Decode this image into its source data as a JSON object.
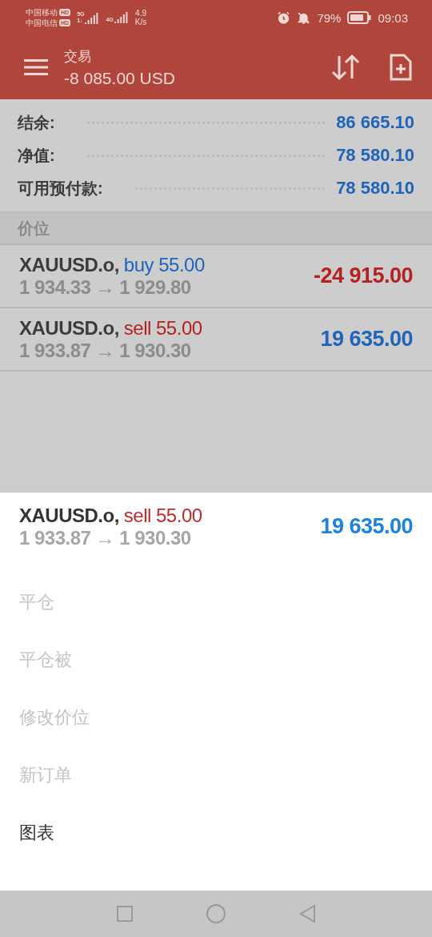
{
  "status_bar": {
    "carriers": [
      {
        "name": "中国移动",
        "badge": "HD"
      },
      {
        "name": "中国电信",
        "badge": "HD"
      }
    ],
    "networks": [
      {
        "label": "5G",
        "sub": "1↓"
      },
      {
        "label": "4G"
      }
    ],
    "speed": [
      "4.9",
      "K/s"
    ],
    "battery": "79%",
    "time": "09:03"
  },
  "header": {
    "title": "交易",
    "balance": "-8 085.00 USD"
  },
  "summary": [
    {
      "label": "结余:",
      "value": "86 665.10"
    },
    {
      "label": "净值:",
      "value": "78 580.10"
    },
    {
      "label": "可用预付款:",
      "value": "78 580.10"
    }
  ],
  "section": "价位",
  "positions": [
    {
      "symbol": "XAUUSD.o,",
      "volume": {
        "text": "buy 55.00",
        "color": "#1f64b8"
      },
      "prices": "1 934.33 → 1 929.80",
      "profit": {
        "text": "-24 915.00",
        "color": "#b32222"
      }
    },
    {
      "symbol": "XAUUSD.o,",
      "volume": {
        "text": "sell 55.00",
        "color": "#b32222"
      },
      "prices": "1 933.87 → 1 930.30",
      "profit": {
        "text": "19 635.00",
        "color": "#1f64b8"
      }
    }
  ],
  "sheet": {
    "position": {
      "symbol": "XAUUSD.o,",
      "volume": {
        "text": "sell 55.00",
        "color": "#c22a2a"
      },
      "prices": "1 933.87 → 1 930.30",
      "profit": {
        "text": "19 635.00",
        "color": "#1a82e0"
      }
    },
    "menu": [
      {
        "label": "平仓",
        "disabled": true
      },
      {
        "label": "平仓被",
        "disabled": true
      },
      {
        "label": "修改价位",
        "disabled": true
      },
      {
        "label": "新订单",
        "disabled": true
      },
      {
        "label": "图表",
        "disabled": false
      }
    ]
  }
}
